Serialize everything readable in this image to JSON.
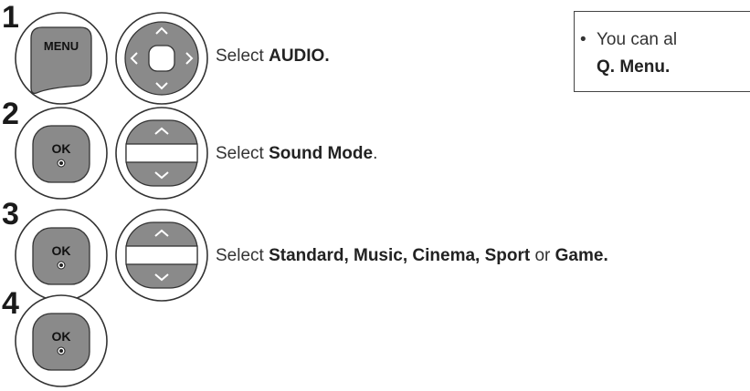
{
  "steps": [
    {
      "number": "1",
      "buttons": [
        "menu-key",
        "navigation-4way"
      ],
      "menu_label": "MENU",
      "prefix": "Select ",
      "bold": "AUDIO.",
      "suffix": ""
    },
    {
      "number": "2",
      "buttons": [
        "ok-key",
        "navigation-updown"
      ],
      "ok_label": "OK",
      "prefix": "Select ",
      "bold": "Sound Mode",
      "suffix": "."
    },
    {
      "number": "3",
      "buttons": [
        "ok-key",
        "navigation-updown"
      ],
      "ok_label": "OK",
      "prefix": "Select ",
      "bold_list": "Standard, Music, Cinema, Sport",
      "connector": " or ",
      "bold_last": "Game."
    },
    {
      "number": "4",
      "buttons": [
        "ok-key"
      ],
      "ok_label": "OK"
    }
  ],
  "note": {
    "bullet": "•",
    "text": "You can al",
    "bold_text": "Q. Menu."
  },
  "colors": {
    "button_fill": "#8a8a8a",
    "button_outline": "#333333",
    "text": "#333333"
  }
}
